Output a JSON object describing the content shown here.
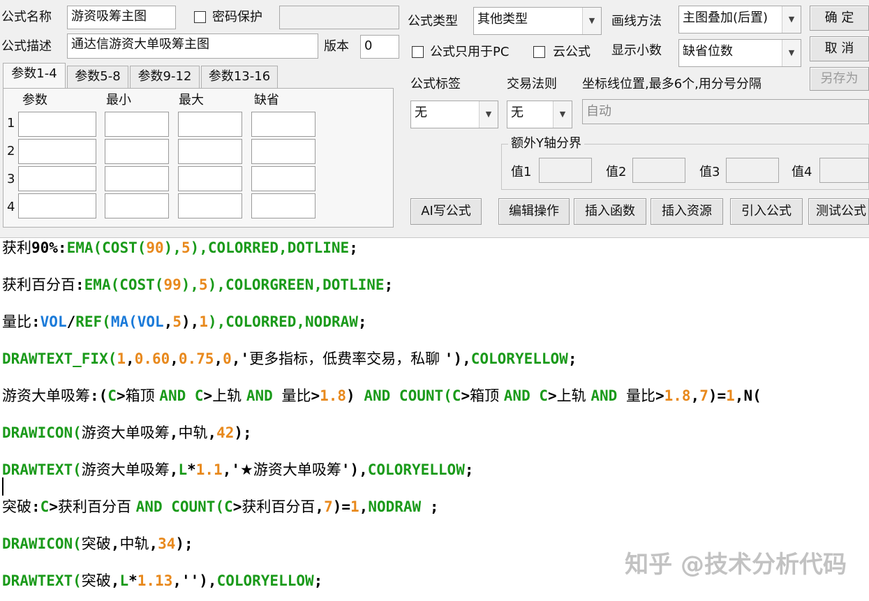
{
  "header": {
    "formula_name_label": "公式名称",
    "formula_name_value": "游资吸筹主图",
    "password_label": "密码保护",
    "formula_desc_label": "公式描述",
    "formula_desc_value": "通达信游资大单吸筹主图",
    "version_label": "版本",
    "version_value": "0"
  },
  "right_panel": {
    "formula_type_label": "公式类型",
    "formula_type_value": "其他类型",
    "draw_method_label": "画线方法",
    "draw_method_value": "主图叠加(后置)",
    "pc_only_label": "公式只用于PC",
    "cloud_label": "云公式",
    "decimals_label": "显示小数",
    "decimals_value": "缺省位数",
    "ok_label": "确  定",
    "cancel_label": "取  消",
    "saveas_label": "另存为",
    "tag_label": "公式标签",
    "tag_value": "无",
    "rule_label": "交易法则",
    "rule_value": "无",
    "axis_label": "坐标线位置,最多6个,用分号分隔",
    "axis_value": "自动",
    "yaxis_group_label": "额外Y轴分界",
    "y_values": [
      "值1",
      "值2",
      "值3",
      "值4"
    ]
  },
  "tabs": [
    "参数1-4",
    "参数5-8",
    "参数9-12",
    "参数13-16"
  ],
  "param_headers": [
    "参数",
    "最小",
    "最大",
    "缺省"
  ],
  "param_rows": [
    "1",
    "2",
    "3",
    "4"
  ],
  "toolbar": [
    "AI写公式",
    "编辑操作",
    "插入函数",
    "插入资源",
    "引入公式",
    "测试公式"
  ],
  "code_lines": [
    [
      [
        "c",
        "获利"
      ],
      [
        "p",
        "90%:"
      ],
      [
        "k",
        "EMA("
      ],
      [
        "k",
        "COST("
      ],
      [
        "n",
        "90"
      ],
      [
        "k",
        "),"
      ],
      [
        "n",
        "5"
      ],
      [
        "k",
        "),COLORRED,DOTLINE"
      ],
      [
        "p",
        ";"
      ]
    ],
    [
      [
        "c",
        "获利百分百"
      ],
      [
        "p",
        ":"
      ],
      [
        "k",
        "EMA("
      ],
      [
        "k",
        "COST("
      ],
      [
        "n",
        "99"
      ],
      [
        "k",
        "),"
      ],
      [
        "n",
        "5"
      ],
      [
        "k",
        "),COLORGREEN,DOTLINE"
      ],
      [
        "p",
        ";"
      ]
    ],
    [
      [
        "c",
        "量比"
      ],
      [
        "p",
        ":"
      ],
      [
        "b",
        "VOL"
      ],
      [
        "p",
        "/"
      ],
      [
        "k",
        "REF("
      ],
      [
        "b",
        "MA("
      ],
      [
        "b",
        "VOL"
      ],
      [
        "p",
        ","
      ],
      [
        "n",
        "5"
      ],
      [
        "p",
        "),"
      ],
      [
        "n",
        "1"
      ],
      [
        "k",
        "),COLORRED,NODRAW"
      ],
      [
        "p",
        ";"
      ]
    ],
    [
      [
        "k",
        "DRAWTEXT_FIX("
      ],
      [
        "n",
        "1"
      ],
      [
        "p",
        ","
      ],
      [
        "n",
        "0.60"
      ],
      [
        "p",
        ","
      ],
      [
        "n",
        "0.75"
      ],
      [
        "p",
        ","
      ],
      [
        "n",
        "0"
      ],
      [
        "p",
        ",'"
      ],
      [
        "c",
        "更多指标，低费率交易，私聊 "
      ],
      [
        "p",
        "'),"
      ],
      [
        "k",
        "COLORYELLOW"
      ],
      [
        "p",
        ";"
      ]
    ],
    [
      [
        "c",
        "游资大单吸筹"
      ],
      [
        "p",
        ":("
      ],
      [
        "k",
        "C"
      ],
      [
        "p",
        ">"
      ],
      [
        "c",
        "箱顶 "
      ],
      [
        "k",
        "AND "
      ],
      [
        "k",
        "C"
      ],
      [
        "p",
        ">"
      ],
      [
        "c",
        "上轨 "
      ],
      [
        "k",
        "AND "
      ],
      [
        "c",
        "量比"
      ],
      [
        "p",
        ">"
      ],
      [
        "n",
        "1.8"
      ],
      [
        "p",
        ") "
      ],
      [
        "k",
        "AND "
      ],
      [
        "k",
        "COUNT("
      ],
      [
        "k",
        "C"
      ],
      [
        "p",
        ">"
      ],
      [
        "c",
        "箱顶 "
      ],
      [
        "k",
        "AND "
      ],
      [
        "k",
        "C"
      ],
      [
        "p",
        ">"
      ],
      [
        "c",
        "上轨 "
      ],
      [
        "k",
        "AND "
      ],
      [
        "c",
        "量比"
      ],
      [
        "p",
        ">"
      ],
      [
        "n",
        "1.8"
      ],
      [
        "p",
        ","
      ],
      [
        "n",
        "7"
      ],
      [
        "p",
        ")="
      ],
      [
        "n",
        "1"
      ],
      [
        "p",
        ",N("
      ]
    ],
    [
      [
        "k",
        "DRAWICON("
      ],
      [
        "c",
        "游资大单吸筹"
      ],
      [
        "p",
        ","
      ],
      [
        "c",
        "中轨"
      ],
      [
        "p",
        ","
      ],
      [
        "n",
        "42"
      ],
      [
        "p",
        ");"
      ]
    ],
    [
      [
        "k",
        "DRAWTEXT("
      ],
      [
        "c",
        "游资大单吸筹"
      ],
      [
        "p",
        ","
      ],
      [
        "k",
        "L"
      ],
      [
        "p",
        "*"
      ],
      [
        "n",
        "1.1"
      ],
      [
        "p",
        ",'"
      ],
      [
        "c",
        "★游资大单吸筹"
      ],
      [
        "p",
        "'),"
      ],
      [
        "k",
        "COLORYELLOW"
      ],
      [
        "p",
        ";"
      ]
    ],
    [
      [
        "c",
        "突破"
      ],
      [
        "p",
        ":"
      ],
      [
        "k",
        "C"
      ],
      [
        "p",
        ">"
      ],
      [
        "c",
        "获利百分百 "
      ],
      [
        "k",
        "AND "
      ],
      [
        "k",
        "COUNT("
      ],
      [
        "k",
        "C"
      ],
      [
        "p",
        ">"
      ],
      [
        "c",
        "获利百分百"
      ],
      [
        "p",
        ","
      ],
      [
        "n",
        "7"
      ],
      [
        "p",
        ")="
      ],
      [
        "n",
        "1"
      ],
      [
        "p",
        ","
      ],
      [
        "k",
        "NODRAW"
      ],
      [
        "p",
        " ;"
      ]
    ],
    [
      [
        "k",
        "DRAWICON("
      ],
      [
        "c",
        "突破"
      ],
      [
        "p",
        ","
      ],
      [
        "c",
        "中轨"
      ],
      [
        "p",
        ","
      ],
      [
        "n",
        "34"
      ],
      [
        "p",
        ");"
      ]
    ],
    [
      [
        "k",
        "DRAWTEXT("
      ],
      [
        "c",
        "突破"
      ],
      [
        "p",
        ","
      ],
      [
        "k",
        "L"
      ],
      [
        "p",
        "*"
      ],
      [
        "n",
        "1.13"
      ],
      [
        "p",
        ",''),"
      ],
      [
        "k",
        "COLORYELLOW"
      ],
      [
        "p",
        ";"
      ]
    ]
  ],
  "watermark": "知乎 @技术分析代码"
}
